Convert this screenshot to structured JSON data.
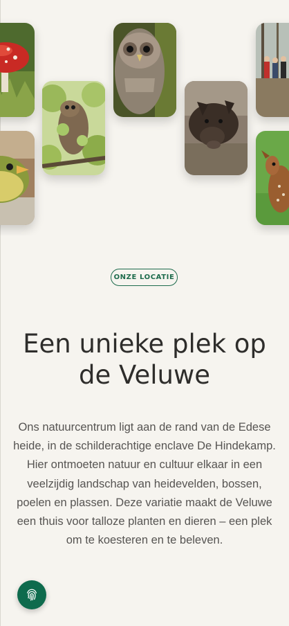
{
  "gallery": {
    "photos": [
      {
        "name": "photo-fly-agaric-mushroom",
        "subject": "mushroom"
      },
      {
        "name": "photo-young-bird",
        "subject": "bird"
      },
      {
        "name": "photo-owl-in-branches",
        "subject": "owl"
      },
      {
        "name": "photo-tawny-owl",
        "subject": "owl"
      },
      {
        "name": "photo-wild-boar",
        "subject": "boar"
      },
      {
        "name": "photo-group-of-visitors",
        "subject": "people"
      },
      {
        "name": "photo-fawn",
        "subject": "deer"
      }
    ]
  },
  "location_badge": {
    "label": "ONZE LOCATIE"
  },
  "heading": {
    "line1": "Een unieke plek op",
    "line2": "de Veluwe"
  },
  "description": "Ons natuurcentrum ligt aan de rand van de Edese heide, in de schilderachtige enclave De Hindekamp. Hier ontmoeten natuur en cultuur elkaar in een veelzijdig landschap van heidevelden, bossen, poelen en plassen. Deze variatie maakt de Veluwe een thuis voor talloze planten en dieren – een plek om te koesteren en te beleven.",
  "fab": {
    "icon": "fingerprint-icon"
  },
  "colors": {
    "background": "#f6f4ef",
    "accent": "#0e6b4d",
    "heading": "#2e2d2b",
    "body": "#565452"
  }
}
